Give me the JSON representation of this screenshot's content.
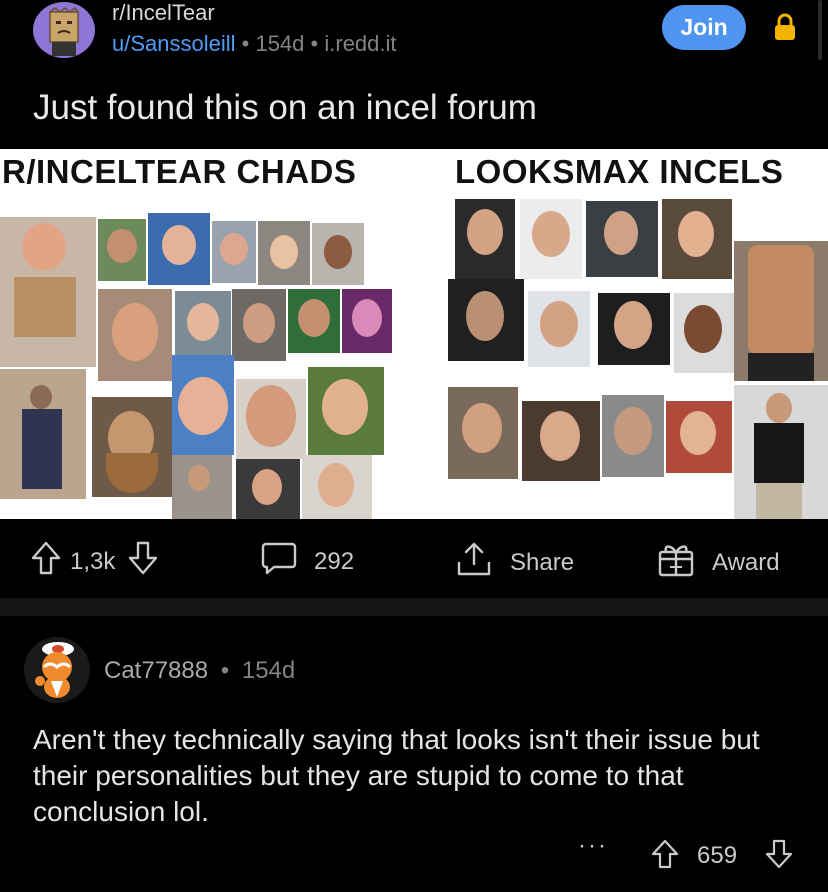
{
  "post": {
    "subreddit": "r/IncelTear",
    "author": "u/Sanssoleill",
    "age": "154d",
    "domain": "i.redd.it",
    "separator": "•",
    "join_label": "Join",
    "title": "Just found this on an incel forum"
  },
  "image": {
    "left_heading": "R/INCELTEAR CHADS",
    "right_heading": "LOOKSMAX INCELS"
  },
  "actions": {
    "upvotes": "1,3k",
    "comments": "292",
    "share_label": "Share",
    "award_label": "Award"
  },
  "comment": {
    "author": "Cat77888",
    "separator": "•",
    "age": "154d",
    "body": "Aren't they technically saying that looks isn't their issue but their personalities but they are stupid to come to that conclusion lol.",
    "more": "···",
    "score": "659"
  },
  "colors": {
    "background": "#000000",
    "join_button": "#4f95f0",
    "user_link": "#4f9bf7",
    "lock": "#f5b400",
    "subreddit_avatar": "#8e76d6"
  },
  "icons": [
    "lock-icon",
    "upvote-icon",
    "downvote-icon",
    "comment-icon",
    "share-icon",
    "award-icon",
    "more-icon"
  ]
}
